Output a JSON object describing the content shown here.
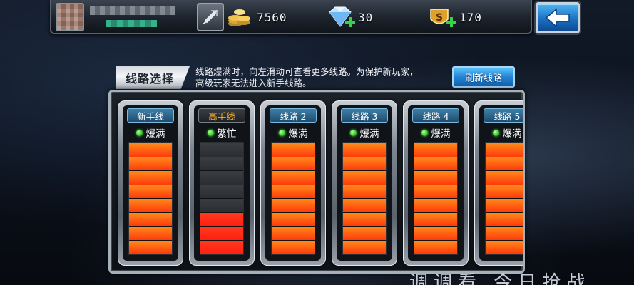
{
  "topbar": {
    "gold": "7560",
    "diamonds": "30",
    "honor": "170"
  },
  "panel": {
    "title": "线路选择",
    "notice_line1": "线路爆满时，向左滑动可查看更多线路。为保护新玩家，",
    "notice_line2": "高级玩家无法进入新手线路。",
    "refresh_label": "刷新线路"
  },
  "lines": [
    {
      "name": "新手线",
      "status": "爆满",
      "load": 1.0,
      "label_color": "#ffffff"
    },
    {
      "name": "高手线",
      "status": "繁忙",
      "load": 0.35,
      "label_color": "#ffb020"
    },
    {
      "name": "线路 2",
      "status": "爆满",
      "load": 1.0,
      "label_color": "#ffffff"
    },
    {
      "name": "线路 3",
      "status": "爆满",
      "load": 1.0,
      "label_color": "#ffffff"
    },
    {
      "name": "线路 4",
      "status": "爆满",
      "load": 1.0,
      "label_color": "#ffffff"
    },
    {
      "name": "线路 5",
      "status": "爆满",
      "load": 1.0,
      "label_color": "#ffffff"
    }
  ],
  "watermark": "调调看 今日抢战",
  "colors": {
    "accent_blue": "#2384d6",
    "gauge_orange": "#ff5a10",
    "status_green": "#3cd12f"
  }
}
